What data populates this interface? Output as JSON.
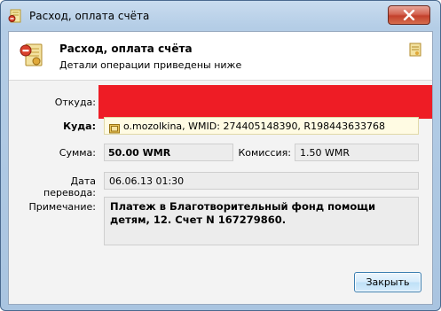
{
  "window": {
    "title": "Расход, оплата счёта"
  },
  "header": {
    "title": "Расход, оплата счёта",
    "subtitle": "Детали операции приведены ниже"
  },
  "form": {
    "from_label": "Откуда:",
    "to_label": "Куда:",
    "to_value": "o.mozolkina, WMID: 274405148390, R198443633768",
    "amount_label": "Сумма:",
    "amount_value": "50.00 WMR",
    "commission_label": "Комиссия:",
    "commission_value": "1.50 WMR",
    "date_label": "Дата перевода:",
    "date_value": "06.06.13 01:30",
    "note_label": "Примечание:",
    "note_value": "Платеж в Благотворительный фонд помощи детям, 12. Счет N 167279860."
  },
  "buttons": {
    "close_label": "Закрыть"
  },
  "colors": {
    "redaction": "#ee1c25",
    "close_button": "#c3402c"
  },
  "icons": {
    "app": "webmoney-invoice-icon",
    "header": "invoice-payment-icon",
    "corner": "note-icon",
    "wallet": "wallet-icon",
    "close": "close-x-icon"
  }
}
